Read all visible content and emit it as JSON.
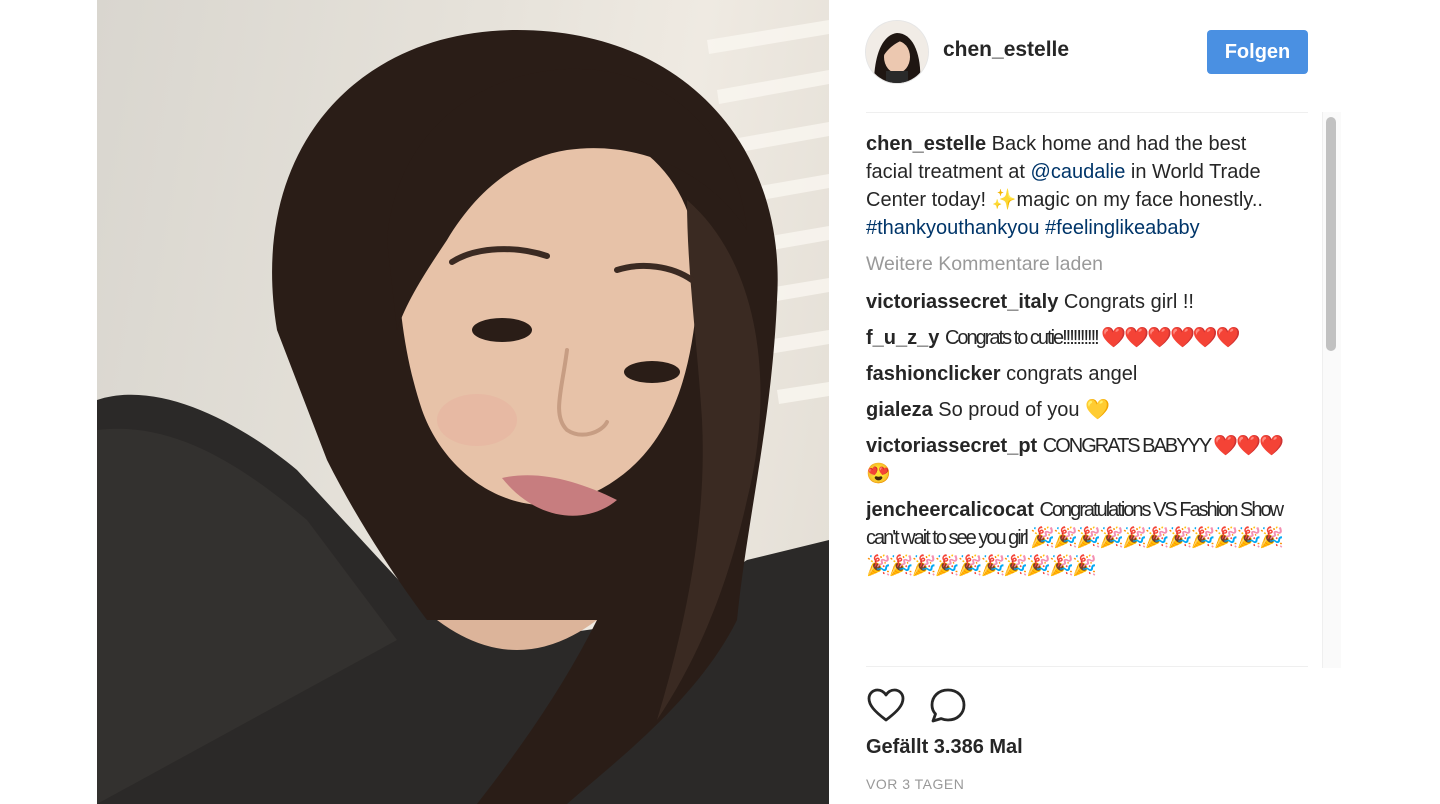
{
  "post": {
    "author": "chen_estelle",
    "follow_label": "Folgen",
    "caption": {
      "username": "chen_estelle",
      "text_1": " Back home and had the best facial treatment at ",
      "mention": "@caudalie",
      "text_2": " in World Trade Center today! ✨magic on my face honestly.. ",
      "tag_1": "#thankyouthankyou",
      "tag_2": "#feelinglikeababy"
    },
    "load_more_label": "Weitere Kommentare laden",
    "comments": [
      {
        "username": "victoriassecret_italy",
        "text": "Congrats girl !!"
      },
      {
        "username": "f_u_z_y",
        "text": "Congrats to cutie!!!!!!!!!! ❤️❤️❤️❤️❤️❤️"
      },
      {
        "username": "fashionclicker",
        "text": "congrats angel"
      },
      {
        "username": "gialeza",
        "text": "So proud of you 💛"
      },
      {
        "username": "victoriassecret_pt",
        "text": "CONGRATS BABYYY ❤️❤️❤️😍"
      },
      {
        "username": "jencheercalicocat",
        "text": "Congratulations VS Fashion Show can't wait to see you girl 🎉🎉🎉🎉🎉🎉🎉🎉🎉🎉🎉🎉🎉🎉🎉🎉🎉🎉🎉🎉🎉"
      }
    ],
    "likes_label": "Gefällt 3.386 Mal",
    "timestamp": "VOR 3 TAGEN"
  },
  "icons": {
    "like": "heart-icon",
    "comment": "comment-bubble-icon"
  },
  "colors": {
    "follow_button": "#4a90e2",
    "link": "#003569",
    "muted": "#999999"
  }
}
